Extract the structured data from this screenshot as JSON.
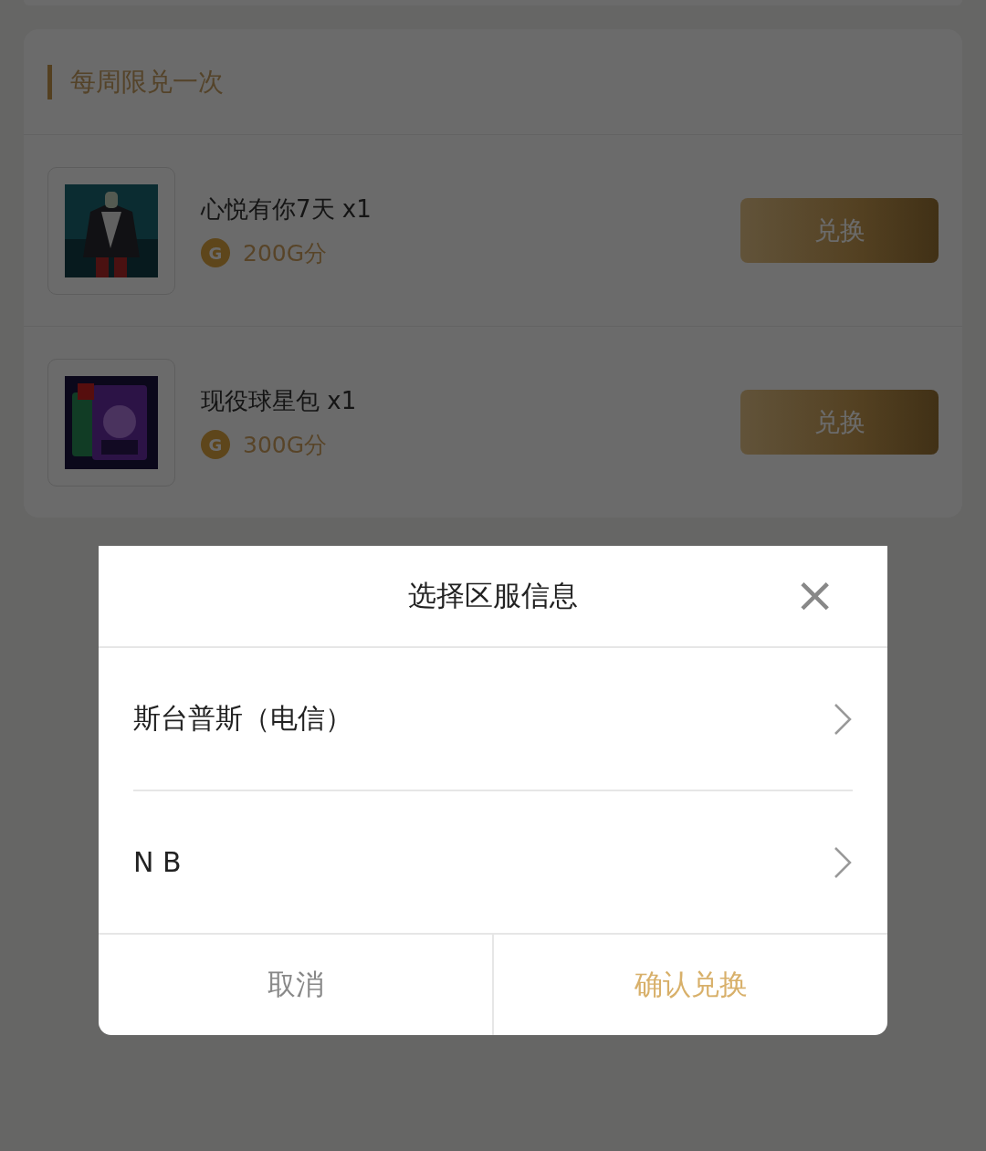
{
  "section": {
    "title": "每周限兑一次"
  },
  "items": [
    {
      "name": "心悦有你7天 x1",
      "coin": "G",
      "price": "200G分",
      "button": "兑换"
    },
    {
      "name": "现役球星包 x1",
      "coin": "G",
      "price": "300G分",
      "button": "兑换"
    }
  ],
  "dialog": {
    "title": "选择区服信息",
    "close": "×",
    "options": [
      {
        "label": "斯台普斯（电信）"
      },
      {
        "label": "N B"
      }
    ],
    "cancel": "取消",
    "confirm": "确认兑换"
  }
}
